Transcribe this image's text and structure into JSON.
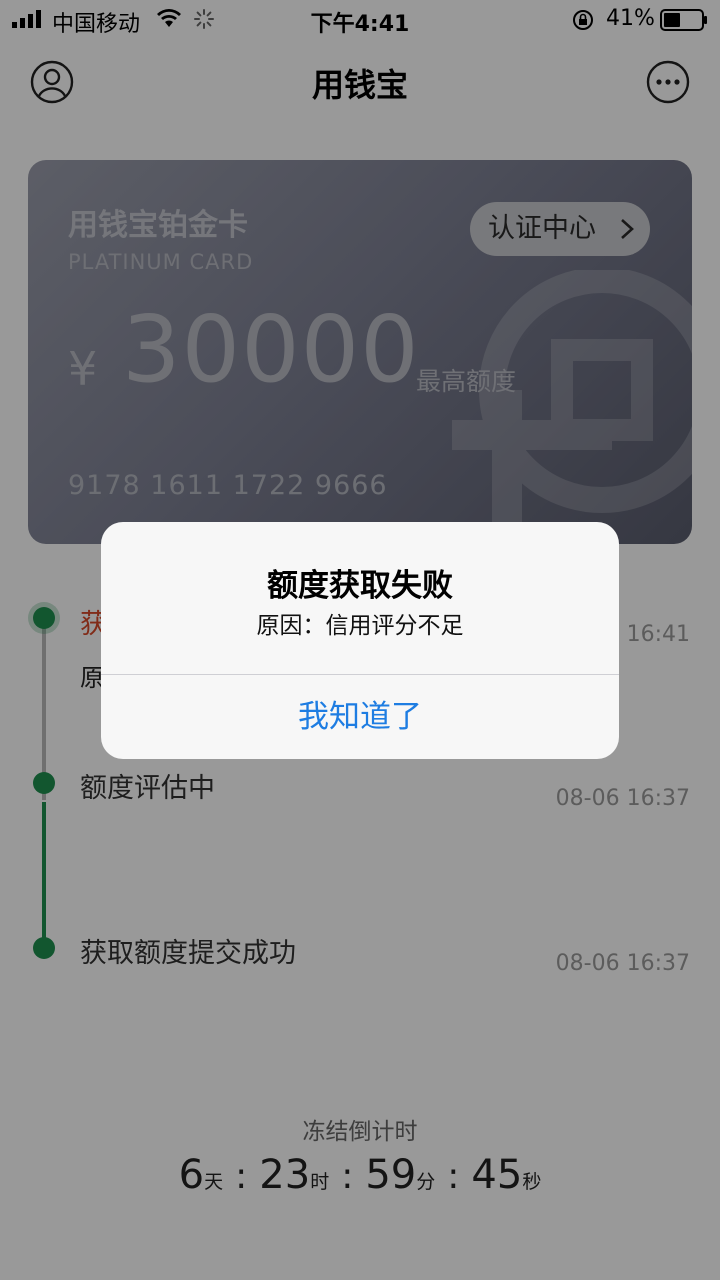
{
  "status_bar": {
    "carrier": "中国移动",
    "time": "下午4:41",
    "battery": "41%"
  },
  "nav": {
    "title": "用钱宝"
  },
  "card": {
    "name": "用钱宝铂金卡",
    "subtitle": "PLATINUM CARD",
    "certification_button": "认证中心",
    "currency": "¥",
    "amount": "30000",
    "amount_label": "最高额度",
    "number": "9178  1611  1722  9666"
  },
  "timeline": {
    "items": [
      {
        "title": "获",
        "time": "6 16:41",
        "desc": "原"
      },
      {
        "title": "额度评估中",
        "time": "08-06 16:37"
      },
      {
        "title": "获取额度提交成功",
        "time": "08-06 16:37"
      }
    ]
  },
  "countdown": {
    "label": "冻结倒计时",
    "days": "6",
    "days_unit": "天",
    "hours": "23",
    "hours_unit": "时",
    "minutes": "59",
    "minutes_unit": "分",
    "seconds": "45",
    "seconds_unit": "秒",
    "separator": ":"
  },
  "dialog": {
    "title": "额度获取失败",
    "message": "原因：信用评分不足",
    "button": "我知道了"
  },
  "colors": {
    "accent_green": "#1f8f4f",
    "alert_red": "#d84a2a",
    "ios_blue": "#1e7de2"
  }
}
